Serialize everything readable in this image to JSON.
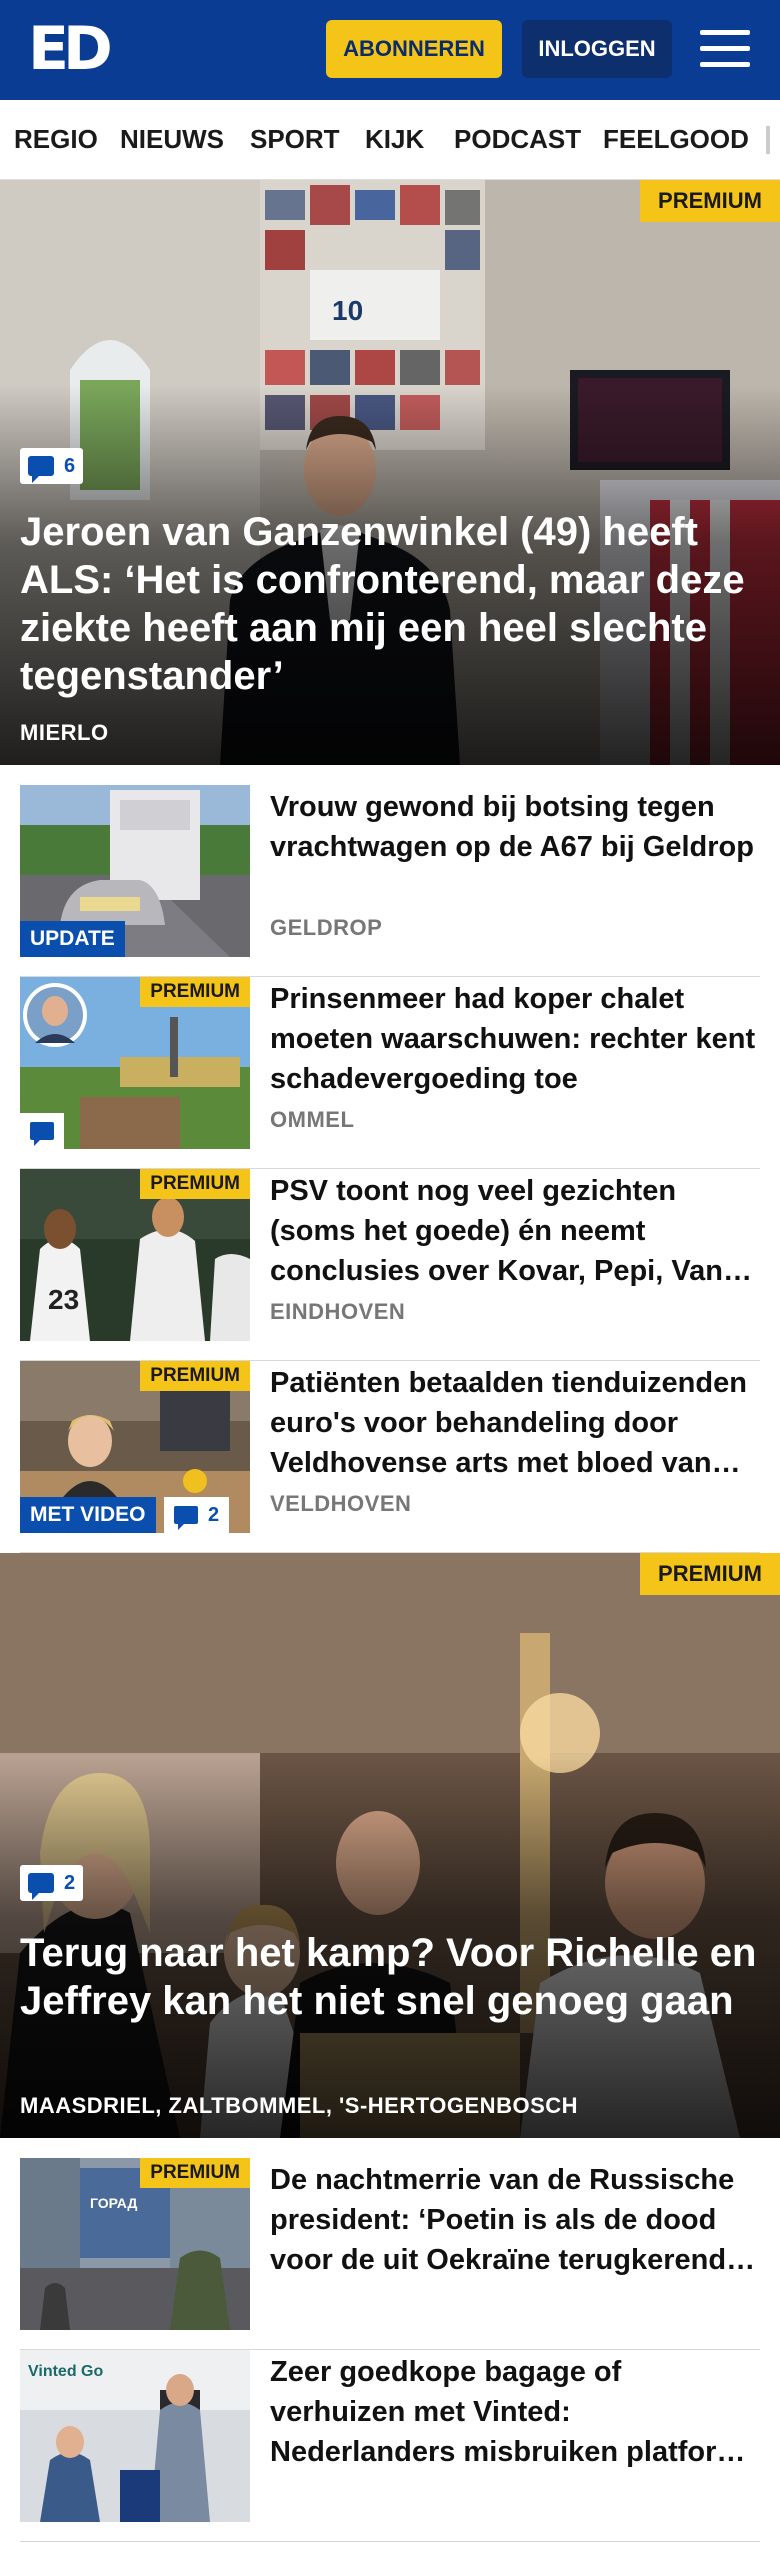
{
  "header": {
    "logo": "ED",
    "subscribe_label": "ABONNEREN",
    "login_label": "INLOGGEN"
  },
  "nav": {
    "items": [
      "REGIO",
      "NIEUWS",
      "SPORT",
      "KIJK",
      "PODCAST",
      "FEELGOOD"
    ]
  },
  "hero1": {
    "premium": "PREMIUM",
    "comments": "6",
    "title": "Jeroen van Ganzenwinkel (49) heeft ALS: ‘Het is confronterend, maar deze ziekte heeft aan mij een heel slechte tegenstander’",
    "location": "MIERLO"
  },
  "articles1": [
    {
      "title": "Vrouw gewond bij botsing tegen vrachtwagen op de A67 bij Geldrop",
      "location": "GELDROP",
      "label": "UPDATE"
    },
    {
      "title": "Prinsenmeer had koper chalet moeten waarschuwen: rechter kent schadevergoeding toe",
      "location": "OMMEL",
      "premium": "PREMIUM"
    },
    {
      "title": "PSV toont nog veel gezichten (soms het goede) én neemt conclusies over Kovar, Pepi, Van Aanholt",
      "location": "EINDHOVEN",
      "premium": "PREMIUM"
    },
    {
      "title": "Patiënten betaalden tienduizenden euro's voor behandeling door Veldhovense arts met bloed van patiënten",
      "location": "VELDHOVEN",
      "premium": "PREMIUM",
      "label": "MET VIDEO",
      "comments": "2"
    }
  ],
  "hero2": {
    "premium": "PREMIUM",
    "comments": "2",
    "title": "Terug naar het kamp? Voor Richelle en Jeffrey kan het niet snel genoeg gaan",
    "location": "MAASDRIEL, ZALTBOMMEL, 'S-HERTOGENBOSCH"
  },
  "articles2": [
    {
      "title": "De nachtmerrie van de Russische president: ‘Poetin is als de dood voor de uit Oekraïne terugkerende soldaten’",
      "location": "",
      "premium": "PREMIUM"
    },
    {
      "title": "Zeer goedkope bagage of verhuizen met Vinted: Nederlanders misbruiken platform op grote schaal",
      "location": ""
    }
  ],
  "colors": {
    "brand_blue": "#0a3c94",
    "premium_yellow": "#f5c418",
    "label_blue": "#0a4fae"
  }
}
